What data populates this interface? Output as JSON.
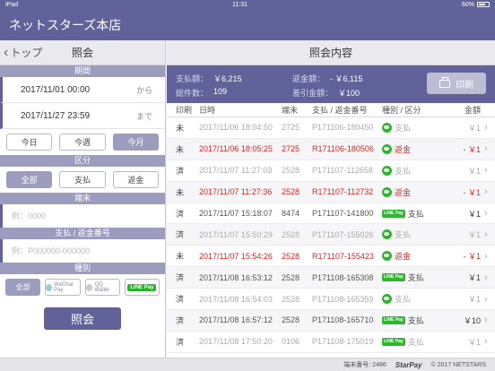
{
  "status": {
    "device": "iPad",
    "time": "11:31",
    "battery": "60%"
  },
  "app_title": "ネットスターズ本店",
  "left": {
    "back_label": "トップ",
    "title": "照会",
    "period_label": "期間",
    "date_from": "2017/11/01 00:00",
    "date_from_suffix": "から",
    "date_to": "2017/11/27 23:59",
    "date_to_suffix": "まで",
    "period_buttons": [
      "今日",
      "今週",
      "今月"
    ],
    "category_label": "区分",
    "category_buttons": [
      "全部",
      "支払",
      "返金"
    ],
    "terminal_label": "端末",
    "terminal_placeholder": "例：0000",
    "number_label": "支払 / 返金番号",
    "number_placeholder": "例：P000000-000000",
    "type_label": "種別",
    "type_buttons": [
      "全部",
      "WeChat Pay",
      "QQ Wallet",
      "LINE Pay"
    ],
    "submit_label": "照会"
  },
  "right": {
    "title": "照会内容",
    "summary": {
      "paid_label": "支払額：",
      "paid_value": "￥6,215",
      "refund_label": "返金額：",
      "refund_value": "- ￥6,115",
      "count_label": "総件数：",
      "count_value": "109",
      "net_label": "差引金額：",
      "net_value": "￥100"
    },
    "print_label": "印刷",
    "columns": [
      "印刷",
      "日時",
      "端末",
      "支払 / 返金番号",
      "種別 / 区分",
      "金額"
    ],
    "rows": [
      {
        "print": "未",
        "datetime": "2017/11/06 18:04:50",
        "terminal": "2725",
        "number": "P171106-180450",
        "payment": "wechat",
        "kind": "支払",
        "amount": "￥1",
        "style": "dim"
      },
      {
        "print": "未",
        "datetime": "2017/11/06 18:05:25",
        "terminal": "2725",
        "number": "R171106-180506",
        "payment": "wechat",
        "kind": "返金",
        "amount": "- ￥1",
        "style": "red"
      },
      {
        "print": "済",
        "datetime": "2017/11/07 11:27:03",
        "terminal": "2528",
        "number": "P171107-112658",
        "payment": "wechat",
        "kind": "支払",
        "amount": "￥1",
        "style": "dim"
      },
      {
        "print": "未",
        "datetime": "2017/11/07 11:27:36",
        "terminal": "2528",
        "number": "R171107-112732",
        "payment": "wechat",
        "kind": "返金",
        "amount": "- ￥1",
        "style": "red"
      },
      {
        "print": "済",
        "datetime": "2017/11/07 15:18:07",
        "terminal": "8474",
        "number": "P171107-141800",
        "payment": "line",
        "kind": "支払",
        "amount": "￥1",
        "style": "normal"
      },
      {
        "print": "済",
        "datetime": "2017/11/07 15:50:29",
        "terminal": "2528",
        "number": "P171107-155026",
        "payment": "wechat",
        "kind": "支払",
        "amount": "￥1",
        "style": "dim"
      },
      {
        "print": "未",
        "datetime": "2017/11/07 15:54:26",
        "terminal": "2528",
        "number": "R171107-155423",
        "payment": "wechat",
        "kind": "返金",
        "amount": "- ￥1",
        "style": "red"
      },
      {
        "print": "済",
        "datetime": "2017/11/08 16:53:12",
        "terminal": "2528",
        "number": "P171108-165308",
        "payment": "line",
        "kind": "支払",
        "amount": "￥1",
        "style": "normal"
      },
      {
        "print": "済",
        "datetime": "2017/11/08 16:54:03",
        "terminal": "2528",
        "number": "P171108-165359",
        "payment": "wechat",
        "kind": "支払",
        "amount": "￥1",
        "style": "dim"
      },
      {
        "print": "済",
        "datetime": "2017/11/08 16:57:12",
        "terminal": "2528",
        "number": "P171108-165710",
        "payment": "line",
        "kind": "支払",
        "amount": "￥10",
        "style": "normal"
      },
      {
        "print": "済",
        "datetime": "2017/11/08 17:50:20",
        "terminal": "0106",
        "number": "P171108-175019",
        "payment": "line",
        "kind": "支払",
        "amount": "￥1",
        "style": "dim"
      }
    ]
  },
  "footer": {
    "terminal_label": "端末番号:",
    "terminal_value": "2486",
    "brand": "StarPay",
    "copyright": "© 2017 NETSTARS"
  },
  "colors": {
    "accent": "#61629a",
    "section": "#9c9cbf",
    "refund": "#e02020",
    "wechat": "#2fb62f"
  }
}
